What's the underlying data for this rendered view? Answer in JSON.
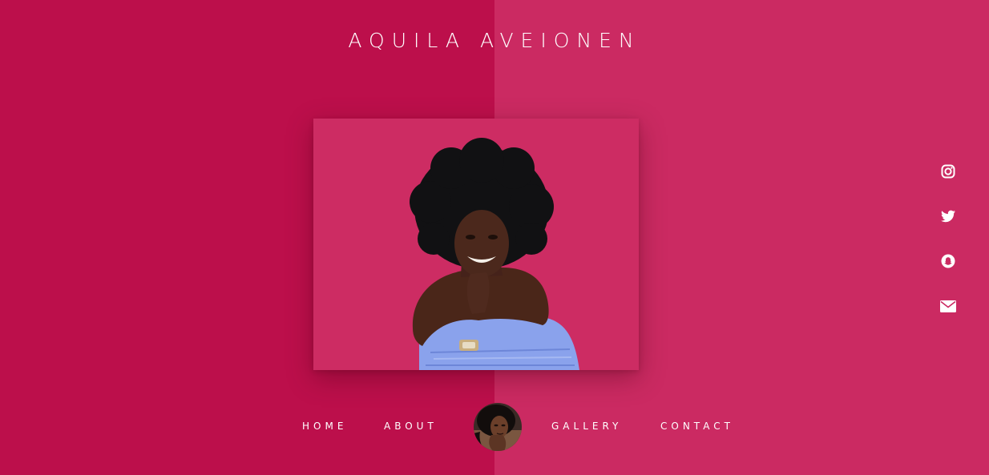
{
  "header": {
    "title": "AQUILA AVEIONEN"
  },
  "colors": {
    "left_panel": "#bc0f4b",
    "right_panel": "#cb2a62",
    "photo_background": "#cd2c63",
    "text": "#ffffff"
  },
  "hero": {
    "image": "portrait-woman-afro-blue-off-shoulder-top"
  },
  "social": [
    {
      "icon": "instagram-icon"
    },
    {
      "icon": "twitter-icon"
    },
    {
      "icon": "snapchat-icon"
    },
    {
      "icon": "email-icon"
    }
  ],
  "nav": {
    "home": "HOME",
    "about": "ABOUT",
    "gallery": "GALLERY",
    "contact": "CONTACT",
    "avatar": "avatar-woman-portrait"
  }
}
